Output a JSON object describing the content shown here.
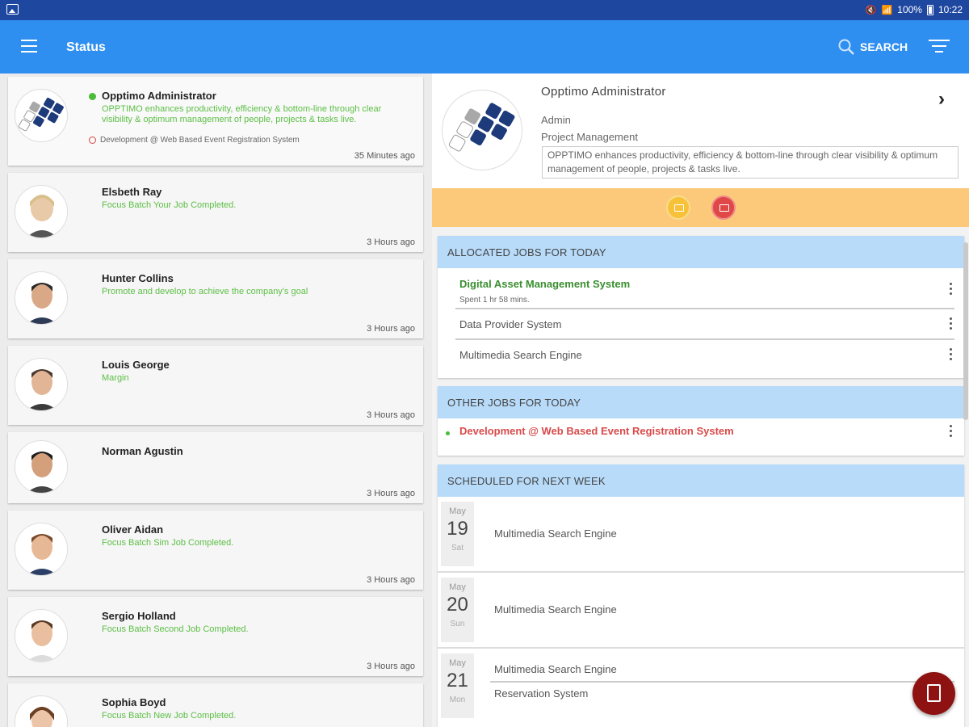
{
  "statusbar": {
    "battery": "100%",
    "time": "10:22"
  },
  "appbar": {
    "title": "Status",
    "search_label": "SEARCH"
  },
  "contacts": [
    {
      "name": "Opptimo Administrator",
      "message": "OPPTIMO enhances productivity, efficiency & bottom-line through clear visibility & optimum management of people, projects & tasks live.",
      "sub": "Development @ Web Based Event Registration System",
      "time": "35 Minutes ago"
    },
    {
      "name": "Elsbeth Ray",
      "message": "Focus Batch Your Job Completed.",
      "time": "3 Hours ago"
    },
    {
      "name": "Hunter Collins",
      "message": "Promote and develop to achieve the company's goal",
      "time": "3 Hours ago"
    },
    {
      "name": "Louis George",
      "message": "Margin",
      "time": "3 Hours ago"
    },
    {
      "name": "Norman Agustin",
      "message": "",
      "time": "3 Hours ago"
    },
    {
      "name": "Oliver Aidan",
      "message": "Focus Batch Sim Job Completed.",
      "time": "3 Hours ago"
    },
    {
      "name": "Sergio Holland",
      "message": "Focus Batch Second Job Completed.",
      "time": "3 Hours ago"
    },
    {
      "name": "Sophia Boyd",
      "message": "Focus Batch New Job Completed.",
      "time": ""
    }
  ],
  "profile": {
    "name": "Opptimo Administrator",
    "role": "Admin",
    "department": "Project Management",
    "description": "OPPTIMO enhances productivity, efficiency & bottom-line through clear visibility & optimum management of people, projects & tasks live."
  },
  "allocated": {
    "heading": "ALLOCATED JOBS FOR TODAY",
    "jobs": [
      {
        "title": "Digital Asset Management System",
        "sub": "Spent 1 hr 58 mins."
      },
      {
        "title": "Data Provider System"
      },
      {
        "title": "Multimedia Search Engine"
      }
    ]
  },
  "other": {
    "heading": "OTHER JOBS FOR TODAY",
    "jobs": [
      {
        "title": "Development @ Web Based Event Registration System"
      }
    ]
  },
  "scheduled": {
    "heading": "SCHEDULED FOR NEXT WEEK",
    "days": [
      {
        "month": "May",
        "day": "19",
        "weekday": "Sat",
        "items": [
          "Multimedia Search Engine"
        ]
      },
      {
        "month": "May",
        "day": "20",
        "weekday": "Sun",
        "items": [
          "Multimedia Search Engine"
        ]
      },
      {
        "month": "May",
        "day": "21",
        "weekday": "Mon",
        "items": [
          "Multimedia Search Engine",
          "Reservation System"
        ]
      }
    ]
  },
  "colors": {
    "appbar": "#2f8ff0",
    "statusbar": "#1e47a0",
    "action_bar": "#fcc97a",
    "section_header": "#b8dbf9",
    "online": "#4cbb3a",
    "fab": "#8e1212"
  }
}
